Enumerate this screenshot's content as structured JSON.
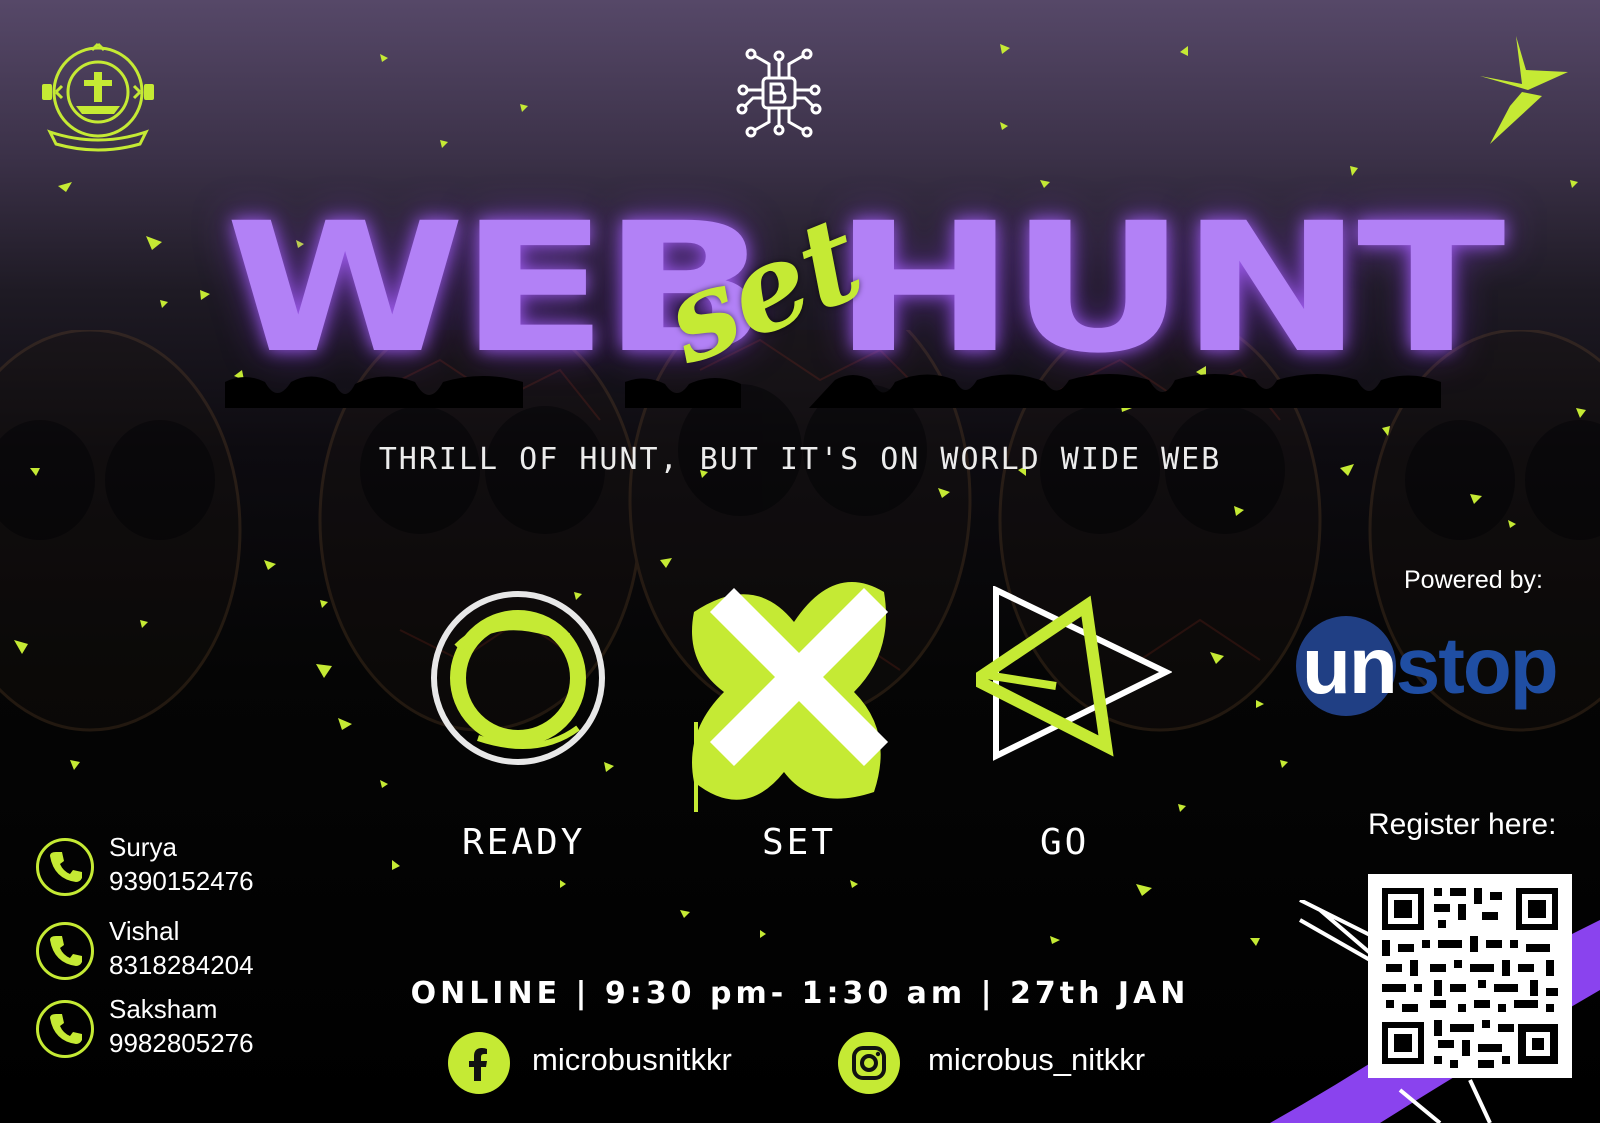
{
  "logos": {
    "institute_logo": {
      "icon": "nit-kurukshetra-emblem-icon"
    },
    "club_logo": {
      "icon": "microbus-circuit-logo-icon"
    },
    "star_logo": {
      "icon": "lime-star-logo-icon"
    }
  },
  "title": {
    "word_left": "WEB",
    "word_mid": "set",
    "word_right": "HUNT"
  },
  "tagline": "THRILL OF HUNT, BUT IT'S ON WORLD WIDE WEB",
  "steps": [
    {
      "label": "READY",
      "icon": "circle-icon"
    },
    {
      "label": "SET",
      "icon": "cross-icon"
    },
    {
      "label": "GO",
      "icon": "play-triangle-icon"
    }
  ],
  "sponsor": {
    "powered_by": "Powered by:",
    "name_part1": "un",
    "name_part2": "stop"
  },
  "register": {
    "label": "Register here:",
    "icon": "qr-code-icon"
  },
  "contacts": [
    {
      "name": "Surya",
      "phone": "9390152476",
      "icon": "phone-icon"
    },
    {
      "name": "Vishal",
      "phone": "8318284204",
      "icon": "phone-icon"
    },
    {
      "name": "Saksham",
      "phone": "9982805276",
      "icon": "phone-icon"
    }
  ],
  "event_info": "ONLINE | 9:30 pm- 1:30 am | 27th JAN",
  "social": {
    "facebook": {
      "handle": "microbusnitkkr",
      "icon": "facebook-icon"
    },
    "instagram": {
      "handle": "microbus_nitkkr",
      "icon": "instagram-icon"
    }
  },
  "colors": {
    "accent_lime": "#c5ea34",
    "title_purple": "#b281f6",
    "sponsor_blue": "#203f84",
    "swoosh_purple": "#8a43ee"
  }
}
